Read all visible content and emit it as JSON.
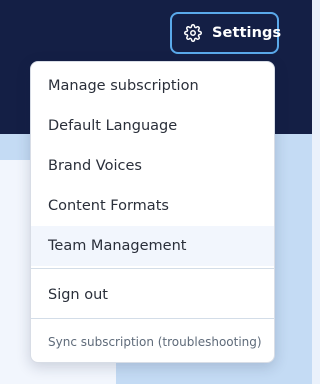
{
  "header": {
    "settings_label": "Settings",
    "settings_icon": "gear-icon"
  },
  "menu": {
    "items": [
      {
        "label": "Manage subscription"
      },
      {
        "label": "Default Language"
      },
      {
        "label": "Brand Voices"
      },
      {
        "label": "Content Formats"
      },
      {
        "label": "Team Management"
      }
    ],
    "sign_out_label": "Sign out",
    "sync_label": "Sync subscription (troubleshooting)"
  },
  "colors": {
    "header_bg": "#141f45",
    "button_border": "#5aa9ea",
    "page_bg": "#c4dbf4",
    "hover_bg": "#f2f6fd"
  }
}
